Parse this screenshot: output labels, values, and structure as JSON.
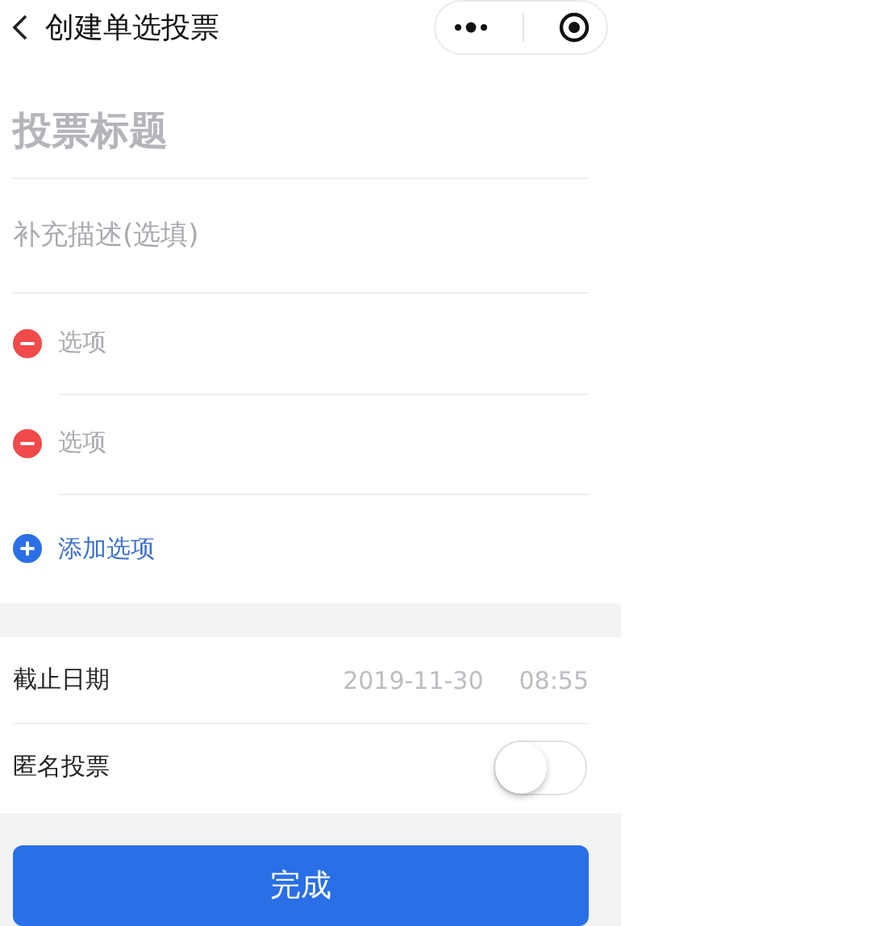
{
  "nav": {
    "title": "创建单选投票"
  },
  "title_field": {
    "placeholder": "投票标题"
  },
  "description_field": {
    "placeholder": "补充描述(选填)"
  },
  "options": [
    {
      "placeholder": "选项"
    },
    {
      "placeholder": "选项"
    }
  ],
  "add_option": {
    "label": "添加选项"
  },
  "deadline": {
    "label": "截止日期",
    "date": "2019-11-30",
    "time": "08:55"
  },
  "anonymous": {
    "label": "匿名投票",
    "on": false
  },
  "submit": {
    "label": "完成"
  }
}
